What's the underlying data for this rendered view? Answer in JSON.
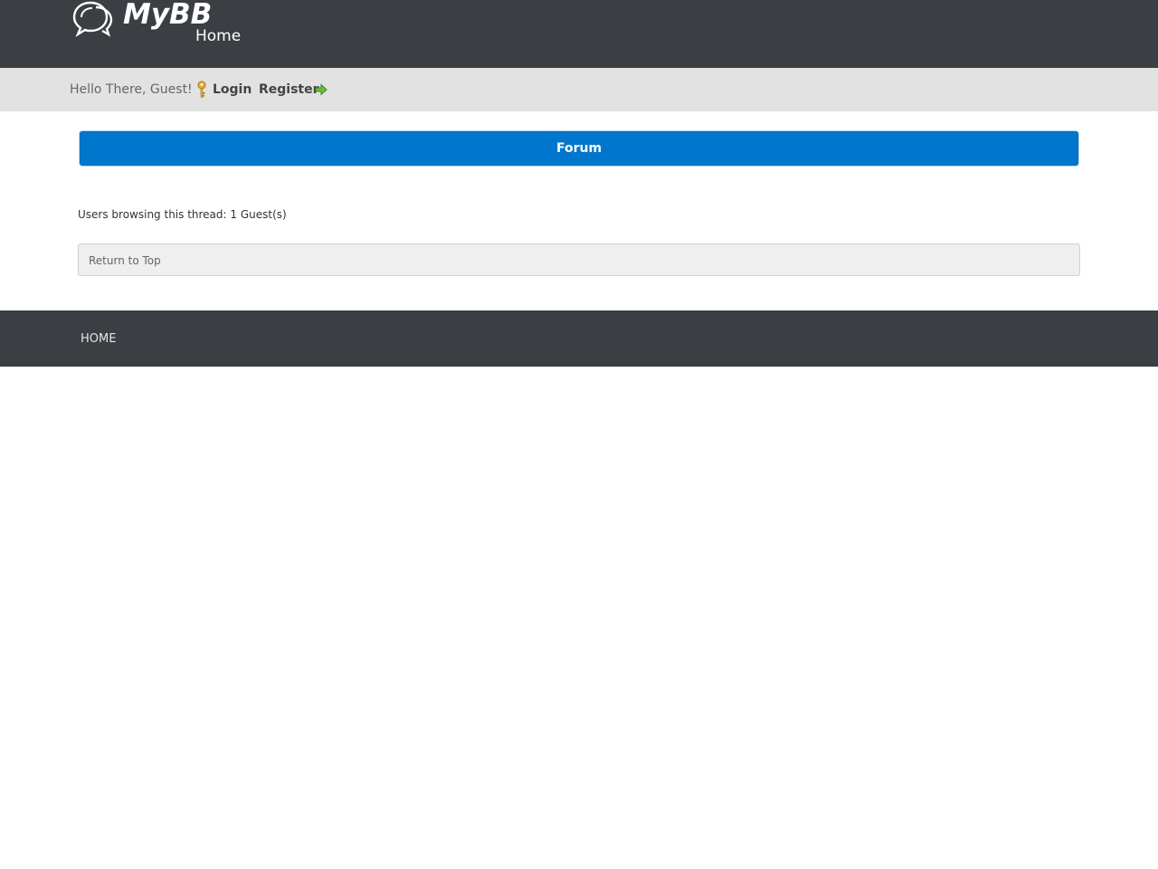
{
  "header": {
    "brand": "MyBB",
    "subtitle": "Home",
    "logo_icon": "speech-bubbles-icon",
    "background": "#3b3e42"
  },
  "userbar": {
    "greeting": "Hello There, Guest!",
    "login_label": "Login",
    "login_icon": "key-icon",
    "register_label": "Register",
    "register_icon": "arrow-right-icon",
    "background": "#e2e2e2"
  },
  "main": {
    "forum_title": "Forum",
    "forum_bar_color": "#0077cc",
    "browsing_text": "Users browsing this thread: 1 Guest(s)",
    "return_to_top": "Return to Top"
  },
  "footer": {
    "home_label": "HOME",
    "background": "#3b3e42"
  }
}
